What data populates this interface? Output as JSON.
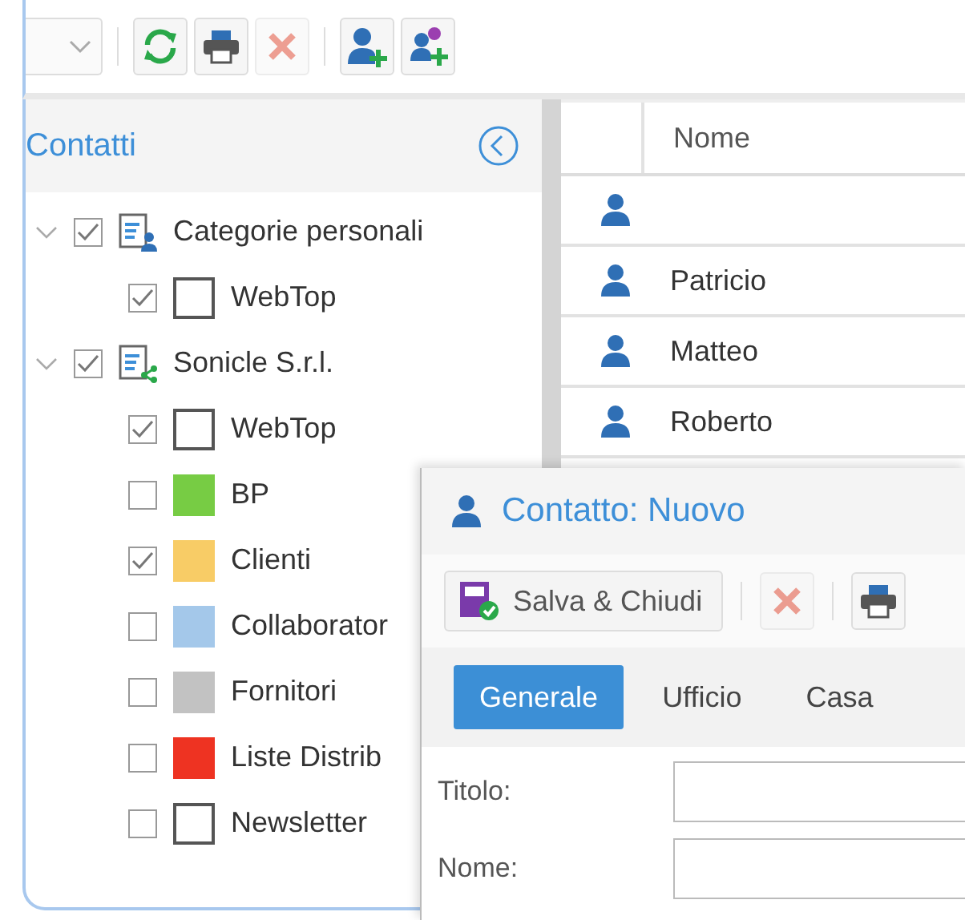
{
  "toolbar": {
    "items": [
      {
        "kind": "combo"
      },
      {
        "kind": "separator"
      },
      {
        "kind": "refresh",
        "disabled": false
      },
      {
        "kind": "print",
        "disabled": false
      },
      {
        "kind": "delete",
        "disabled": true
      },
      {
        "kind": "separator"
      },
      {
        "kind": "add-contact",
        "disabled": false
      },
      {
        "kind": "add-list",
        "disabled": false
      }
    ]
  },
  "sidebar": {
    "title": "Contatti",
    "items": [
      {
        "label": "Categorie personali",
        "kind": "personal",
        "expanded": true,
        "checked": true,
        "children": [
          {
            "label": "WebTop",
            "checked": true,
            "color": "#ffffff"
          }
        ]
      },
      {
        "label": "Sonicle S.r.l.",
        "kind": "shared",
        "expanded": true,
        "checked": true,
        "children": [
          {
            "label": "WebTop",
            "checked": true,
            "color": "#ffffff"
          },
          {
            "label": "BP",
            "checked": false,
            "color": "#77cc44"
          },
          {
            "label": "Clienti",
            "checked": true,
            "color": "#f8cc66"
          },
          {
            "label": "Collaborator",
            "checked": false,
            "color": "#a4c8ea"
          },
          {
            "label": "Fornitori",
            "checked": false,
            "color": "#c2c2c2"
          },
          {
            "label": "Liste Distrib",
            "checked": false,
            "color": "#ee3322"
          },
          {
            "label": "Newsletter",
            "checked": false,
            "color": "#ffffff"
          }
        ]
      }
    ]
  },
  "table": {
    "columns": [
      "Nome"
    ],
    "rows": [
      {
        "nome": ""
      },
      {
        "nome": "Patricio"
      },
      {
        "nome": "Matteo"
      },
      {
        "nome": "Roberto"
      }
    ]
  },
  "dialog": {
    "title": "Contatto: Nuovo",
    "toolbar": [
      {
        "kind": "save",
        "label": "Salva & Chiudi",
        "disabled": false
      },
      {
        "kind": "separator"
      },
      {
        "kind": "delete",
        "disabled": true
      },
      {
        "kind": "separator"
      },
      {
        "kind": "print",
        "disabled": false
      }
    ],
    "tabs": [
      {
        "label": "Generale",
        "selected": true
      },
      {
        "label": "Ufficio",
        "selected": false
      },
      {
        "label": "Casa",
        "selected": false
      }
    ],
    "fields": [
      {
        "label": "Titolo:"
      },
      {
        "label": "Nome:"
      }
    ]
  }
}
